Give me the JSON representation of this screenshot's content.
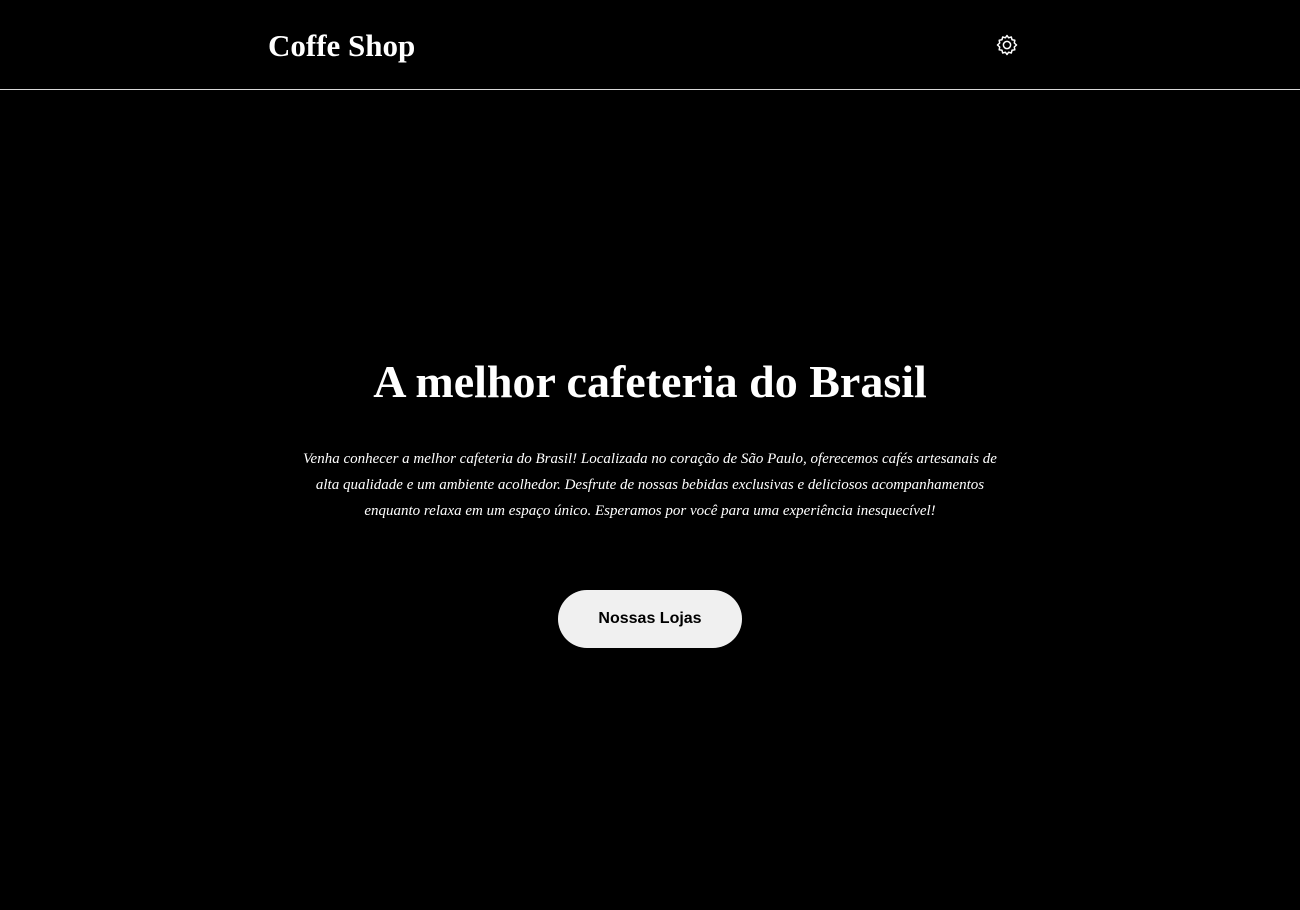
{
  "header": {
    "brand": "Coffe Shop",
    "settings_icon": "gear-icon"
  },
  "hero": {
    "title": "A melhor cafeteria do Brasil",
    "description": "Venha conhecer a melhor cafeteria do Brasil! Localizada no coração de São Paulo, oferecemos cafés artesanais de alta qualidade e um ambiente acolhedor. Desfrute de nossas bebidas exclusivas e deliciosos acompanhamentos enquanto relaxa em um espaço único. Esperamos por você para uma experiência inesquecível!",
    "cta_label": "Nossas Lojas"
  },
  "colors": {
    "background": "#000000",
    "text": "#ffffff",
    "button_bg": "#f0f0f0",
    "button_text": "#000000",
    "divider": "#d9d9d9"
  }
}
